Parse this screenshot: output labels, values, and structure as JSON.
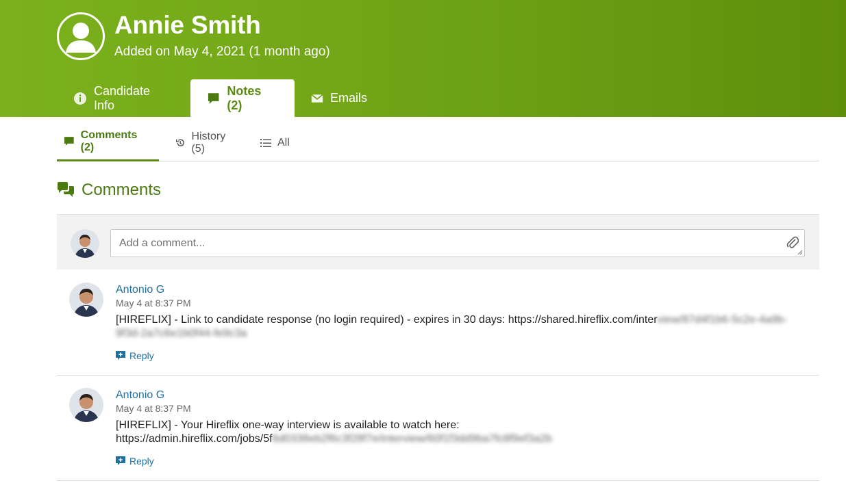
{
  "header": {
    "name": "Annie Smith",
    "added_text": "Added on May 4, 2021 (1 month ago)",
    "accent": "#7cb11d"
  },
  "tabs": [
    {
      "label": "Candidate Info",
      "icon": "info-icon"
    },
    {
      "label": "Notes (2)",
      "icon": "comment-icon",
      "active": true
    },
    {
      "label": "Emails",
      "icon": "envelope-icon"
    }
  ],
  "subtabs": [
    {
      "label": "Comments (2)",
      "icon": "comment-icon",
      "active": true
    },
    {
      "label": "History (5)",
      "icon": "history-icon"
    },
    {
      "label": "All",
      "icon": "list-icon"
    }
  ],
  "section_title": "Comments",
  "composer": {
    "placeholder": "Add a comment..."
  },
  "comments": [
    {
      "author": "Antonio G",
      "time": "May 4 at 8:37 PM",
      "text": "[HIREFLIX] - Link to candidate response (no login required) - expires in 30 days: https://shared.hireflix.com/inter",
      "blurred": "view/87d4f1b6-5c2e-4a9b-9f3d-2a7c6e1b0f44-fe9c3a",
      "reply_label": "Reply"
    },
    {
      "author": "Antonio G",
      "time": "May 4 at 8:37 PM",
      "text": "[HIREFLIX] - Your Hireflix one-way interview is available to watch here:",
      "link": "https://admin.hireflix.com/jobs/5f",
      "blurred": "6d0338eb2f6c3f28f7e/interview/60f1f3dd9ba7fc8f9ef3a2b",
      "reply_label": "Reply"
    }
  ]
}
